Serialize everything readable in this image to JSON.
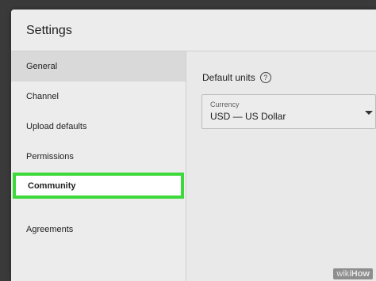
{
  "dialog": {
    "title": "Settings"
  },
  "sidebar": {
    "items": [
      {
        "label": "General"
      },
      {
        "label": "Channel"
      },
      {
        "label": "Upload defaults"
      },
      {
        "label": "Permissions"
      },
      {
        "label": "Community"
      },
      {
        "label": "Agreements"
      }
    ],
    "active_item": "General",
    "highlighted_item": "Community",
    "highlight_color": "#3dd83a"
  },
  "content": {
    "section_title": "Default units",
    "help_icon": "help-circle-icon",
    "currency": {
      "label": "Currency",
      "value": "USD — US Dollar"
    }
  },
  "watermark": {
    "prefix": "wiki",
    "suffix": "How"
  }
}
